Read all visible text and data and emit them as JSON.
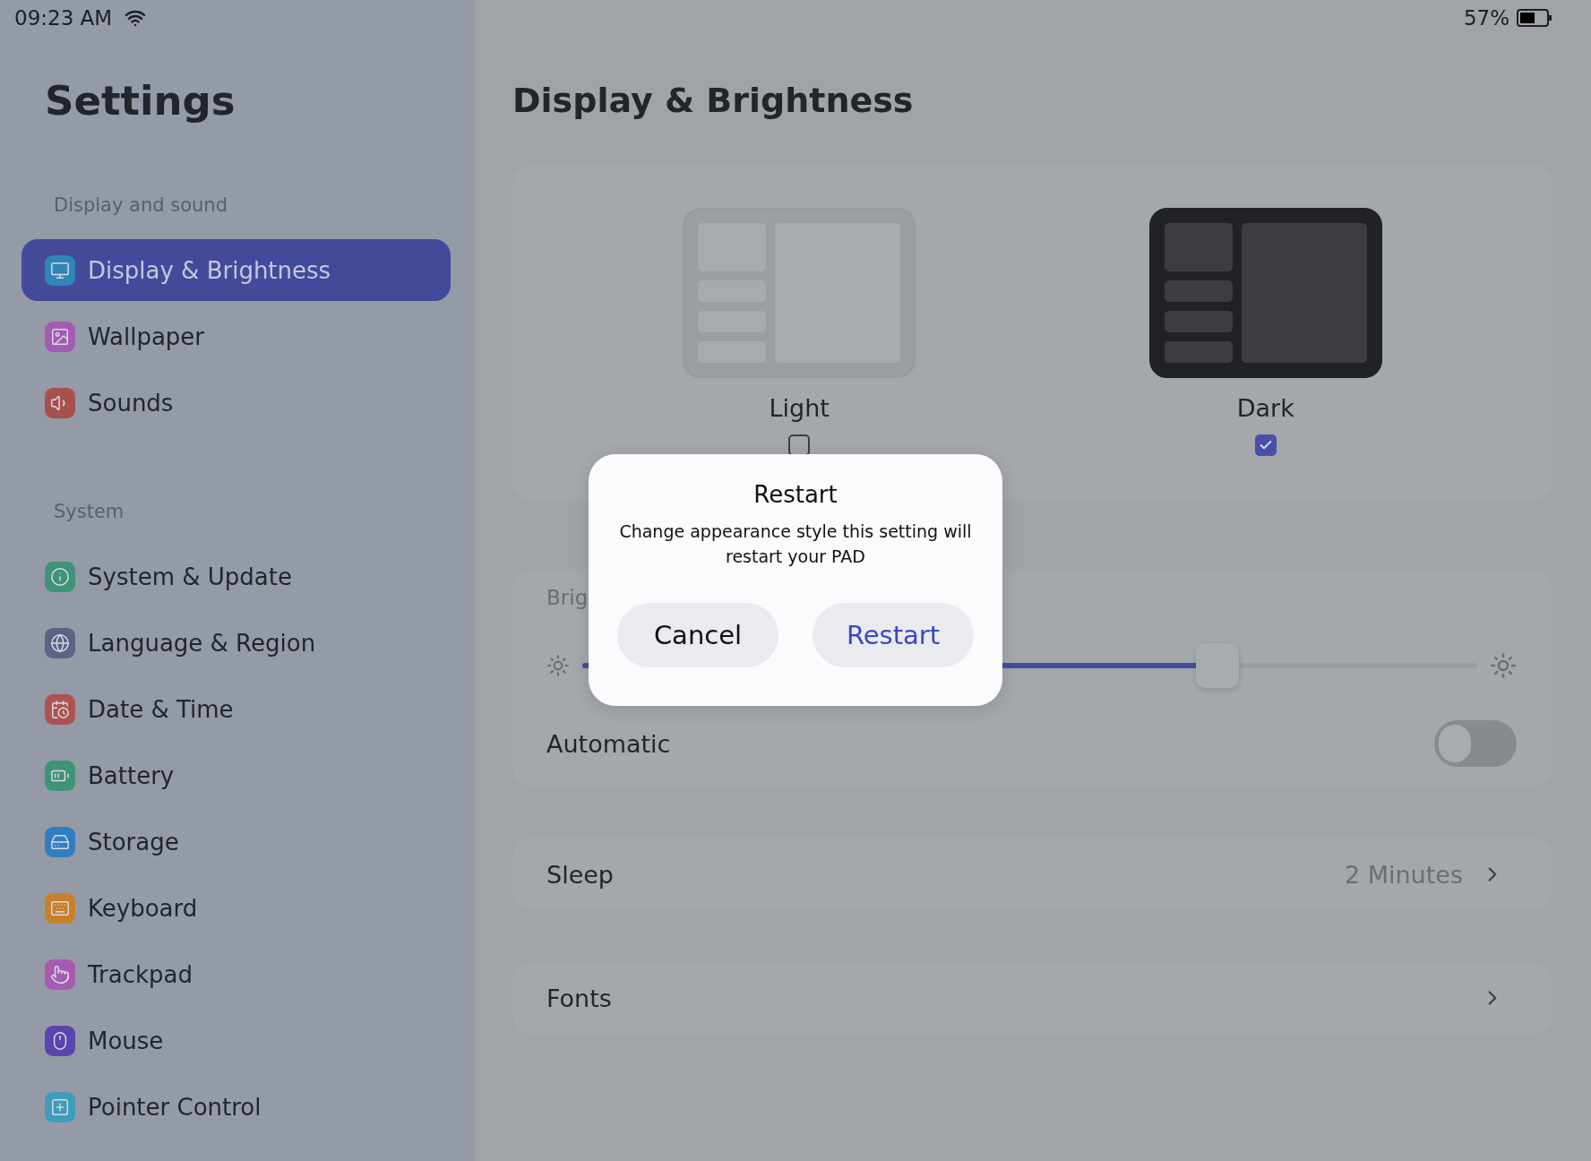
{
  "status_bar": {
    "time": "09:23 AM",
    "battery": "57%"
  },
  "sidebar": {
    "title": "Settings",
    "sections": [
      {
        "heading": "Display and sound",
        "items": [
          {
            "label": "Display & Brightness",
            "selected": true,
            "color": "#2f86b8"
          },
          {
            "label": "Wallpaper",
            "selected": false,
            "color": "#a25db3"
          },
          {
            "label": "Sounds",
            "selected": false,
            "color": "#a7514f"
          }
        ]
      },
      {
        "heading": "System",
        "items": [
          {
            "label": "System & Update",
            "selected": false,
            "color": "#3f9379"
          },
          {
            "label": "Language & Region",
            "selected": false,
            "color": "#5e6285"
          },
          {
            "label": "Date & Time",
            "selected": false,
            "color": "#ad5453"
          },
          {
            "label": "Battery",
            "selected": false,
            "color": "#3f9379"
          },
          {
            "label": "Storage",
            "selected": false,
            "color": "#2f7fc0"
          },
          {
            "label": "Keyboard",
            "selected": false,
            "color": "#c77f2a"
          },
          {
            "label": "Trackpad",
            "selected": false,
            "color": "#a75cb3"
          },
          {
            "label": "Mouse",
            "selected": false,
            "color": "#5b45ad"
          },
          {
            "label": "Pointer Control",
            "selected": false,
            "color": "#3d9dbb"
          }
        ]
      }
    ]
  },
  "content": {
    "title": "Display & Brightness",
    "appearance": [
      {
        "label": "Light",
        "kind": "light",
        "selected": false
      },
      {
        "label": "Dark",
        "kind": "dark",
        "selected": true
      }
    ],
    "brightness": {
      "label": "Brig",
      "level": 0.71,
      "automatic": {
        "label": "Automatic",
        "on": false
      }
    },
    "rows": [
      {
        "label": "Sleep",
        "value": "2 Minutes"
      },
      {
        "label": "Fonts"
      }
    ]
  },
  "dialog": {
    "title": "Restart",
    "message": "Change appearance style this setting will restart your PAD",
    "buttons": [
      {
        "label": "Cancel",
        "kind": "cancel"
      },
      {
        "label": "Restart",
        "kind": "confirm"
      }
    ]
  }
}
